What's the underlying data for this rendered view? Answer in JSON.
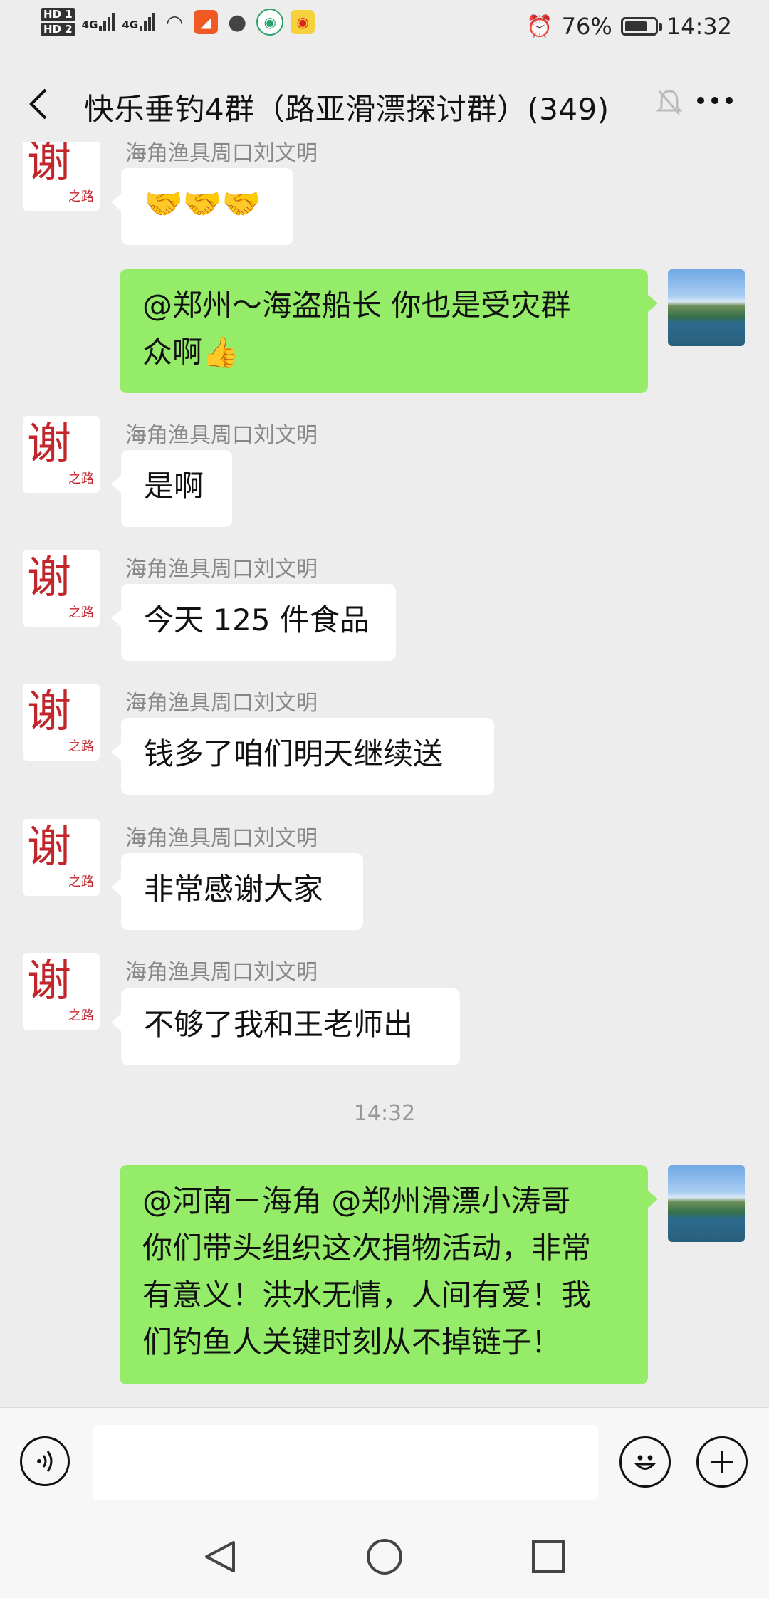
{
  "status": {
    "hd1": "HD 1",
    "hd2": "HD 2",
    "net1": "4G",
    "net2": "4G",
    "battery_text": "76%",
    "battery_level": 0.76,
    "time": "14:32"
  },
  "header": {
    "title": "快乐垂钓4群（路亚滑漂探讨群）(349)"
  },
  "avatar_text": {
    "logo": "谢",
    "sub": "之路"
  },
  "messages": [
    {
      "side": "left",
      "sender": "海角渔具周口刘文明",
      "text": "🤝🤝🤝"
    },
    {
      "side": "right",
      "text_lines": [
        "@郑州～海盗船长  你也是受灾群",
        "众啊👍"
      ]
    },
    {
      "side": "left",
      "sender": "海角渔具周口刘文明",
      "text": "是啊"
    },
    {
      "side": "left",
      "sender": "海角渔具周口刘文明",
      "text": "今天 125 件食品"
    },
    {
      "side": "left",
      "sender": "海角渔具周口刘文明",
      "text": "钱多了咱们明天继续送"
    },
    {
      "side": "left",
      "sender": "海角渔具周口刘文明",
      "text": "非常感谢大家"
    },
    {
      "side": "left",
      "sender": "海角渔具周口刘文明",
      "text": "不够了我和王老师出"
    },
    {
      "type": "time",
      "text": "14:32"
    },
    {
      "side": "right",
      "text_lines": [
        "@河南－海角  @郑州滑漂小涛哥",
        "你们带头组织这次捐物活动，非常",
        "有意义！洪水无情，人间有爱！我",
        "们钓鱼人关键时刻从不掉链子！"
      ]
    }
  ],
  "icons": {
    "back": "back-arrow-icon",
    "mute": "bell-muted-icon",
    "more": "more-dots-icon",
    "voice": "voice-icon",
    "emoji": "emoji-icon",
    "plus": "plus-icon",
    "nav_back": "nav-back-icon",
    "nav_home": "nav-home-icon",
    "nav_recent": "nav-recent-icon"
  }
}
